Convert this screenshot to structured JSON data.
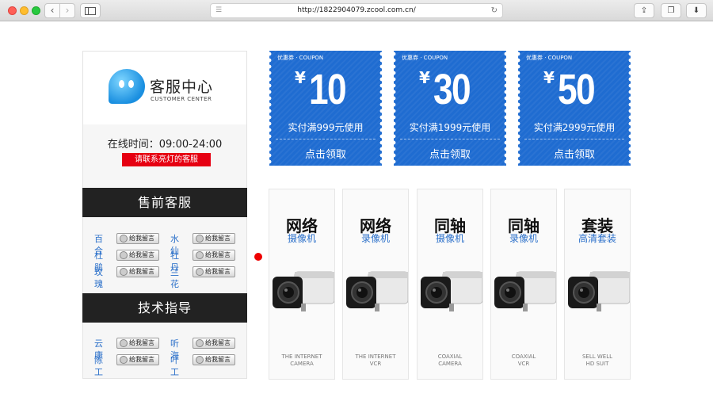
{
  "browser": {
    "url": "http://1822904079.zcool.com.cn/",
    "back_glyph": "‹",
    "fwd_glyph": "›",
    "share_glyph": "⇪",
    "tabs_glyph": "❐",
    "download_glyph": "⬇"
  },
  "service": {
    "logo_title": "客服中心",
    "logo_sub": "CUSTOMER CENTER",
    "hours": "在线时间：09:00-24:00",
    "hours_note": "请联系亮灯的客服",
    "presale_title": "售前客服",
    "tech_title": "技术指导",
    "msg_label": "给我留言",
    "presale_agents": [
      "百合",
      "水仙",
      "杜鹃",
      "牡丹",
      "玫瑰",
      "兰花"
    ],
    "tech_agents": [
      "云康",
      "听海",
      "陈工",
      "叶工"
    ]
  },
  "coupons": [
    {
      "tag": "优惠券 · COUPON",
      "symbol": "¥",
      "amount": "10",
      "condition": "实付满999元使用",
      "action": "点击领取"
    },
    {
      "tag": "优惠券 · COUPON",
      "symbol": "¥",
      "amount": "30",
      "condition": "实付满1999元使用",
      "action": "点击领取"
    },
    {
      "tag": "优惠券 · COUPON",
      "symbol": "¥",
      "amount": "50",
      "condition": "实付满2999元使用",
      "action": "点击领取"
    }
  ],
  "products": [
    {
      "title": "网络",
      "subtitle": "摄像机",
      "en1": "THE INTERNET",
      "en2": "CAMERA"
    },
    {
      "title": "网络",
      "subtitle": "录像机",
      "en1": "THE INTERNET",
      "en2": "VCR"
    },
    {
      "title": "同轴",
      "subtitle": "摄像机",
      "en1": "COAXIAL",
      "en2": "CAMERA"
    },
    {
      "title": "同轴",
      "subtitle": "录像机",
      "en1": "COAXIAL",
      "en2": "VCR"
    },
    {
      "title": "套装",
      "subtitle": "高清套装",
      "en1": "SELL WELL",
      "en2": "HD SUIT"
    }
  ],
  "colors": {
    "coupon_blue": "#1f6cd1",
    "accent_red": "#e60012",
    "link_blue": "#2a6fc9"
  }
}
